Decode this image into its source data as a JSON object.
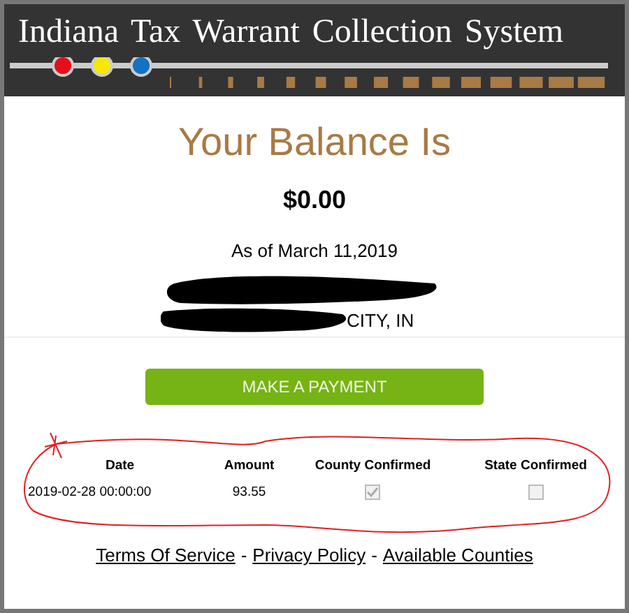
{
  "header": {
    "title": "Indiana Tax Warrant Collection System"
  },
  "balance_heading": "Your Balance Is",
  "balance": "$0.00",
  "as_of": "As of March 11,2019",
  "address_line": "CITY, IN",
  "payment_button": "MAKE A PAYMENT",
  "table": {
    "columns": [
      "Date",
      "Amount",
      "County Confirmed",
      "State Confirmed"
    ],
    "rows": [
      {
        "date": "2019-02-28 00:00:00",
        "amount": "93.55",
        "county_confirmed": true,
        "state_confirmed": false
      }
    ]
  },
  "footer": {
    "separator": "-",
    "links": [
      "Terms Of Service",
      "Privacy Policy",
      "Available Counties"
    ]
  }
}
